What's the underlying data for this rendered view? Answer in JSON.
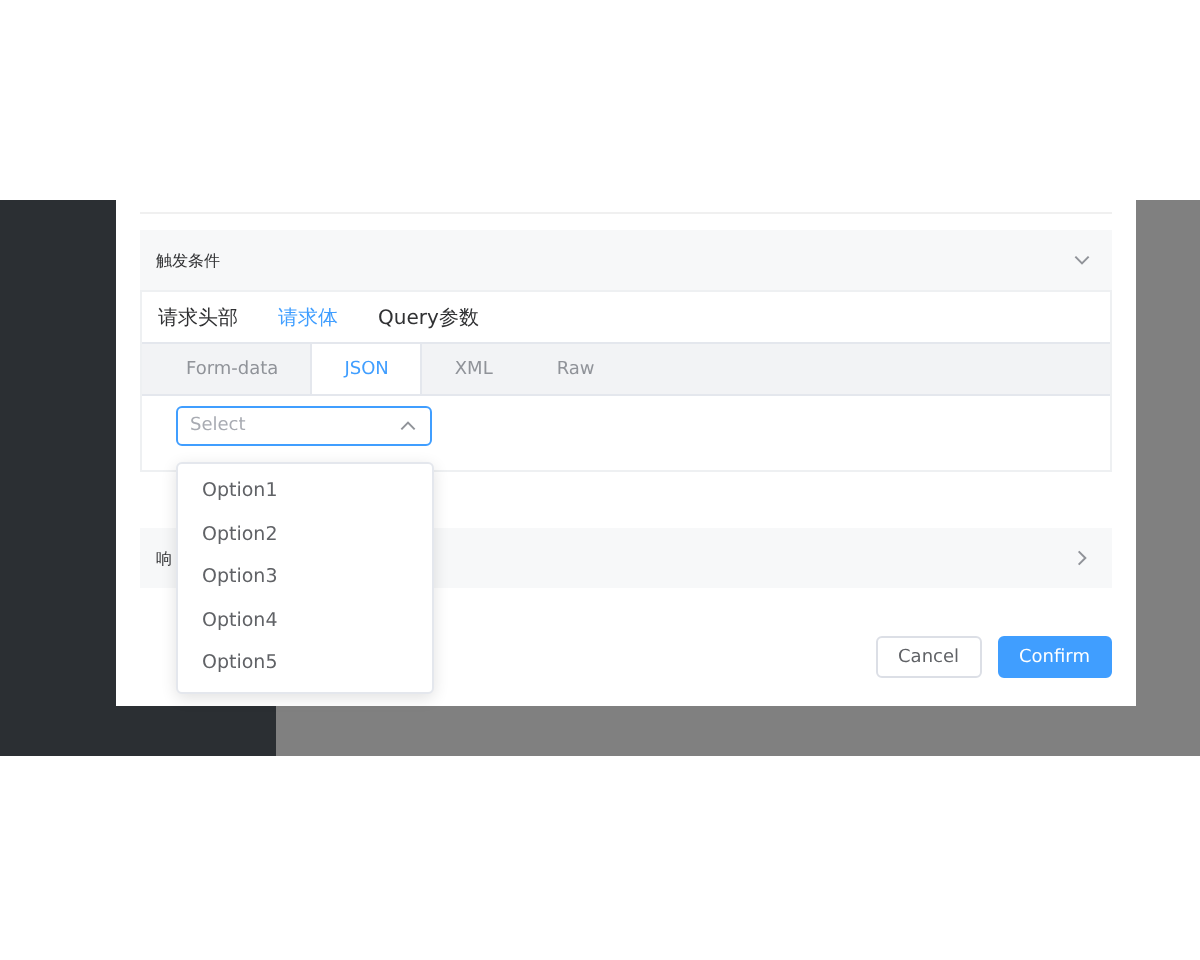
{
  "dialog": {
    "sections": [
      {
        "title": "触发条件",
        "expanded": true
      },
      {
        "title": "响",
        "expanded": false
      }
    ],
    "request_tabs": [
      {
        "label": "请求头部",
        "selected": false
      },
      {
        "label": "请求体",
        "selected": true
      },
      {
        "label": "Query参数",
        "selected": false
      }
    ],
    "body_tabs": [
      {
        "label": "Form-data",
        "selected": false
      },
      {
        "label": "JSON",
        "selected": true
      },
      {
        "label": "XML",
        "selected": false
      },
      {
        "label": "Raw",
        "selected": false
      }
    ],
    "select": {
      "placeholder": "Select",
      "open": true,
      "options": [
        "Option1",
        "Option2",
        "Option3",
        "Option4",
        "Option5"
      ]
    },
    "buttons": [
      {
        "label": "Cancel",
        "kind": "default"
      },
      {
        "label": "Confirm",
        "kind": "primary"
      }
    ]
  }
}
